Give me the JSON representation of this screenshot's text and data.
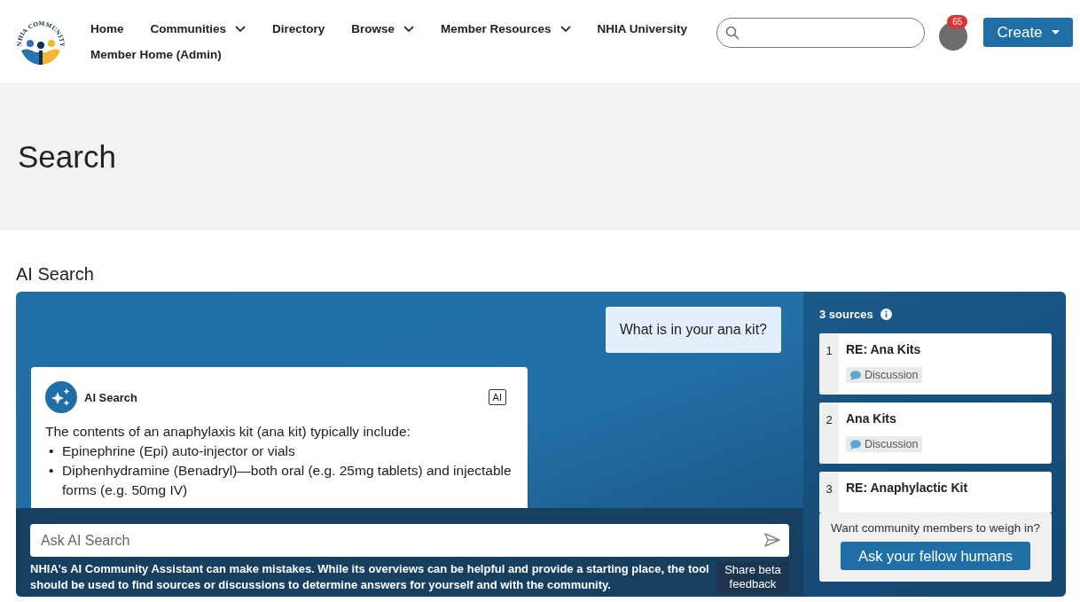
{
  "logo": {
    "text": "NHIA COMMUNITY"
  },
  "nav": [
    {
      "label": "Home",
      "dropdown": false
    },
    {
      "label": "Communities",
      "dropdown": true
    },
    {
      "label": "Directory",
      "dropdown": false
    },
    {
      "label": "Browse",
      "dropdown": true
    },
    {
      "label": "Member Resources",
      "dropdown": true
    },
    {
      "label": "NHIA University",
      "dropdown": false
    },
    {
      "label": "Member Home (Admin)",
      "dropdown": false
    }
  ],
  "notifications": {
    "count": "65"
  },
  "create_button": "Create",
  "page_title": "Search",
  "section_title": "AI Search",
  "chat": {
    "user_message": "What is in your ana kit?",
    "response": {
      "author": "AI Search",
      "badge": "AI",
      "intro": "The contents of an anaphylaxis kit (ana kit) typically include:",
      "items": [
        {
          "marker": "•",
          "text": "Epinephrine (Epi) auto-injector or vials"
        },
        {
          "marker": "•",
          "text": "Diphenhydramine (Benadryl)—both oral (e.g. 25mg tablets) and injectable forms (e.g. 50mg IV)"
        }
      ]
    }
  },
  "input": {
    "placeholder": "Ask AI Search"
  },
  "disclaimer": "NHIA's AI Community Assistant can make mistakes. While its overviews can be helpful and provide a starting place, the tool should be used to find sources or discussions to determine answers for yourself and with the community.",
  "feedback_button": "Share beta feedback",
  "sources": {
    "title": "3 sources",
    "items": [
      {
        "number": "1",
        "title": "RE: Ana Kits",
        "tag": "Discussion"
      },
      {
        "number": "2",
        "title": "Ana Kits",
        "tag": "Discussion"
      },
      {
        "number": "3",
        "title": "RE: Anaphylactic Kit"
      }
    ]
  },
  "cta": {
    "prompt": "Want community members to weigh in?",
    "button": "Ask your fellow humans"
  }
}
